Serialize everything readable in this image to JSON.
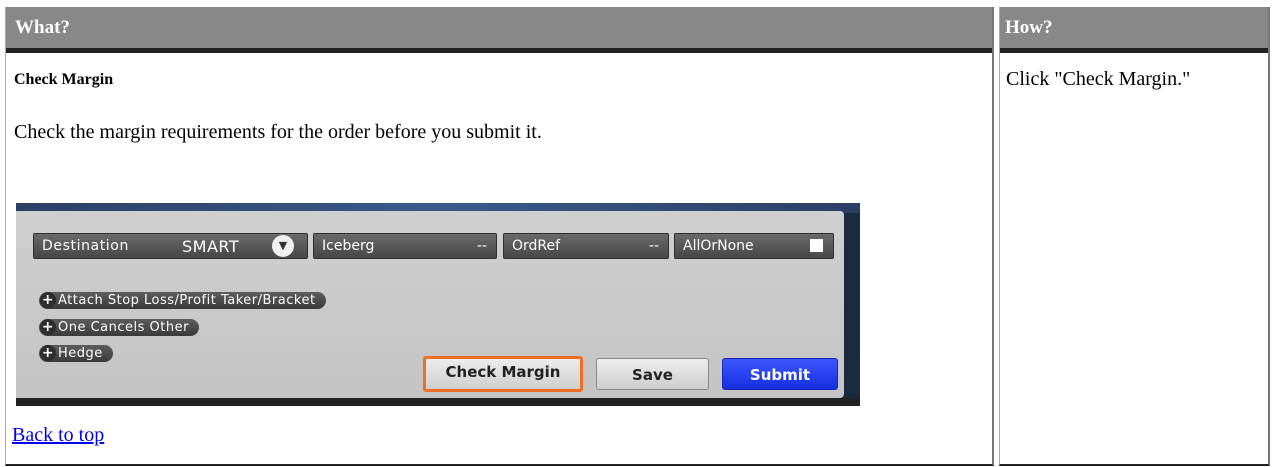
{
  "table": {
    "what_header": "What?",
    "how_header": "How?"
  },
  "what": {
    "heading": "Check Margin",
    "description": "Check the margin requirements for the order before you submit it.",
    "back_link": "Back to top"
  },
  "how": {
    "text": "Click \"Check Margin.\""
  },
  "screenshot": {
    "destination_label": "Destination",
    "destination_value": "SMART",
    "iceberg_label": "Iceberg",
    "iceberg_value": "--",
    "ordref_label": "OrdRef",
    "ordref_value": "--",
    "allornone_label": "AllOrNone",
    "attach_label": "Attach Stop Loss/Profit Taker/Bracket",
    "oco_label": "One Cancels Other",
    "hedge_label": "Hedge",
    "check_margin_button": "Check Margin",
    "save_button": "Save",
    "submit_button": "Submit",
    "colors": {
      "highlight": "#ee6e22",
      "submit": "#1f3bf0"
    }
  }
}
